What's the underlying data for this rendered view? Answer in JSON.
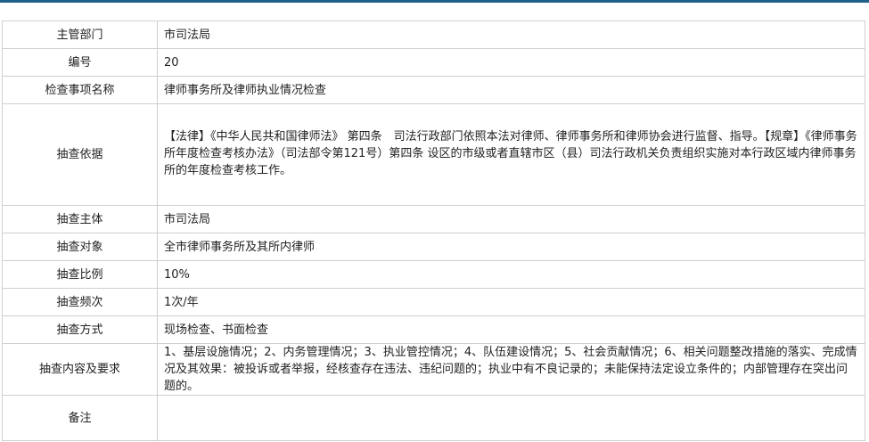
{
  "table": {
    "rows": [
      {
        "label": "主管部门",
        "value": "市司法局"
      },
      {
        "label": "编号",
        "value": "20"
      },
      {
        "label": "检查事项名称",
        "value": "律师事务所及律师执业情况检查"
      },
      {
        "label": "抽查依据",
        "value": "【法律】《中华人民共和国律师法》 第四条　司法行政部门依照本法对律师、律师事务所和律师协会进行监督、指导。【规章】《律师事务所年度检查考核办法》（司法部令第121号）第四条 设区的市级或者直辖市区（县）司法行政机关负责组织实施对本行政区域内律师事务所的年度检查考核工作。"
      },
      {
        "label": "抽查主体",
        "value": "市司法局"
      },
      {
        "label": "抽查对象",
        "value": "全市律师事务所及其所内律师"
      },
      {
        "label": "抽查比例",
        "value": "10%"
      },
      {
        "label": "抽查频次",
        "value": "1次/年"
      },
      {
        "label": "抽查方式",
        "value": "现场检查、书面检查"
      },
      {
        "label": "抽查内容及要求",
        "value": "1、基层设施情况；2、内务管理情况；3、执业管控情况；4、队伍建设情况；5、社会贡献情况；6、相关问题整改措施的落实、完成情况及其效果：被投诉或者举报，经核查存在违法、违纪问题的；执业中有不良记录的；未能保持法定设立条件的；内部管理存在突出问题的。"
      },
      {
        "label": "备注",
        "value": ""
      }
    ]
  }
}
